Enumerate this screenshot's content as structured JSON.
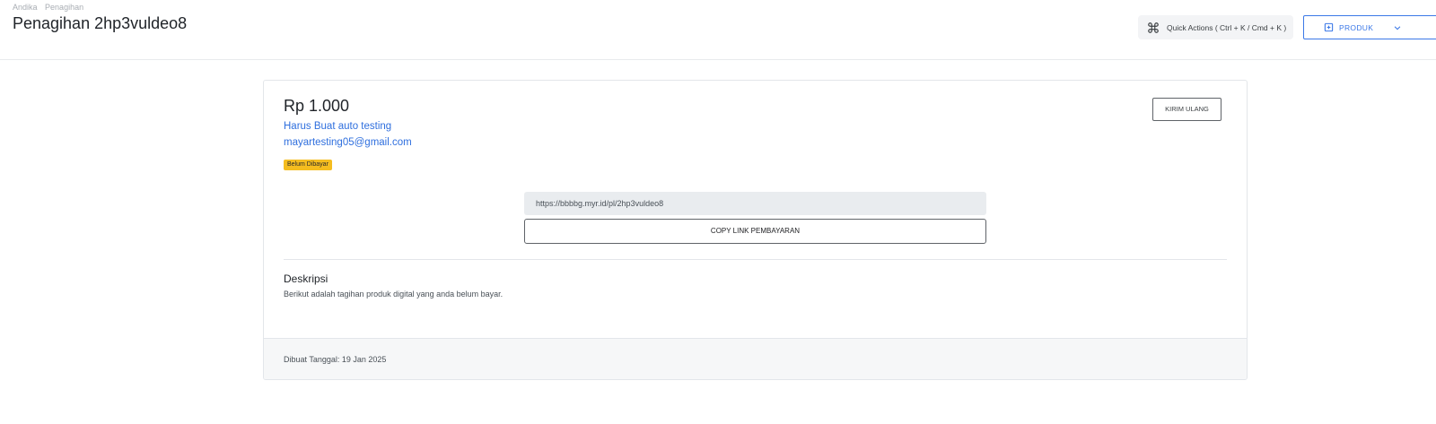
{
  "breadcrumb": [
    "Andika",
    "Penagihan"
  ],
  "header": {
    "title": "Penagihan 2hp3vuldeo8",
    "quick_actions_label": "Quick Actions ( Ctrl + K / Cmd + K )",
    "quick_actions_icon": "command-icon",
    "produk_label": "PRODUK",
    "produk_icon": "plus-square-icon",
    "produk_chevron_icon": "chevron-down-icon"
  },
  "invoice": {
    "amount": "Rp 1.000",
    "product_name": "Harus Buat auto testing",
    "email": "mayartesting05@gmail.com",
    "status": "Belum Dibayar",
    "resend_label": "KIRIM ULANG",
    "payment_link": "https://bbbbg.myr.id/pl/2hp3vuldeo8",
    "copy_label": "COPY LINK PEMBAYARAN",
    "description_heading": "Deskripsi",
    "description_text": "Berikut adalah tagihan produk digital yang anda belum bayar.",
    "created_label": "Dibuat Tanggal: 19 Jan 2025"
  },
  "colors": {
    "accent": "#3b78e7",
    "link": "#2f6fde",
    "status_badge": "#f5bd1f",
    "link_field_bg": "#e9ecef",
    "footer_bg": "#f6f7f8"
  }
}
